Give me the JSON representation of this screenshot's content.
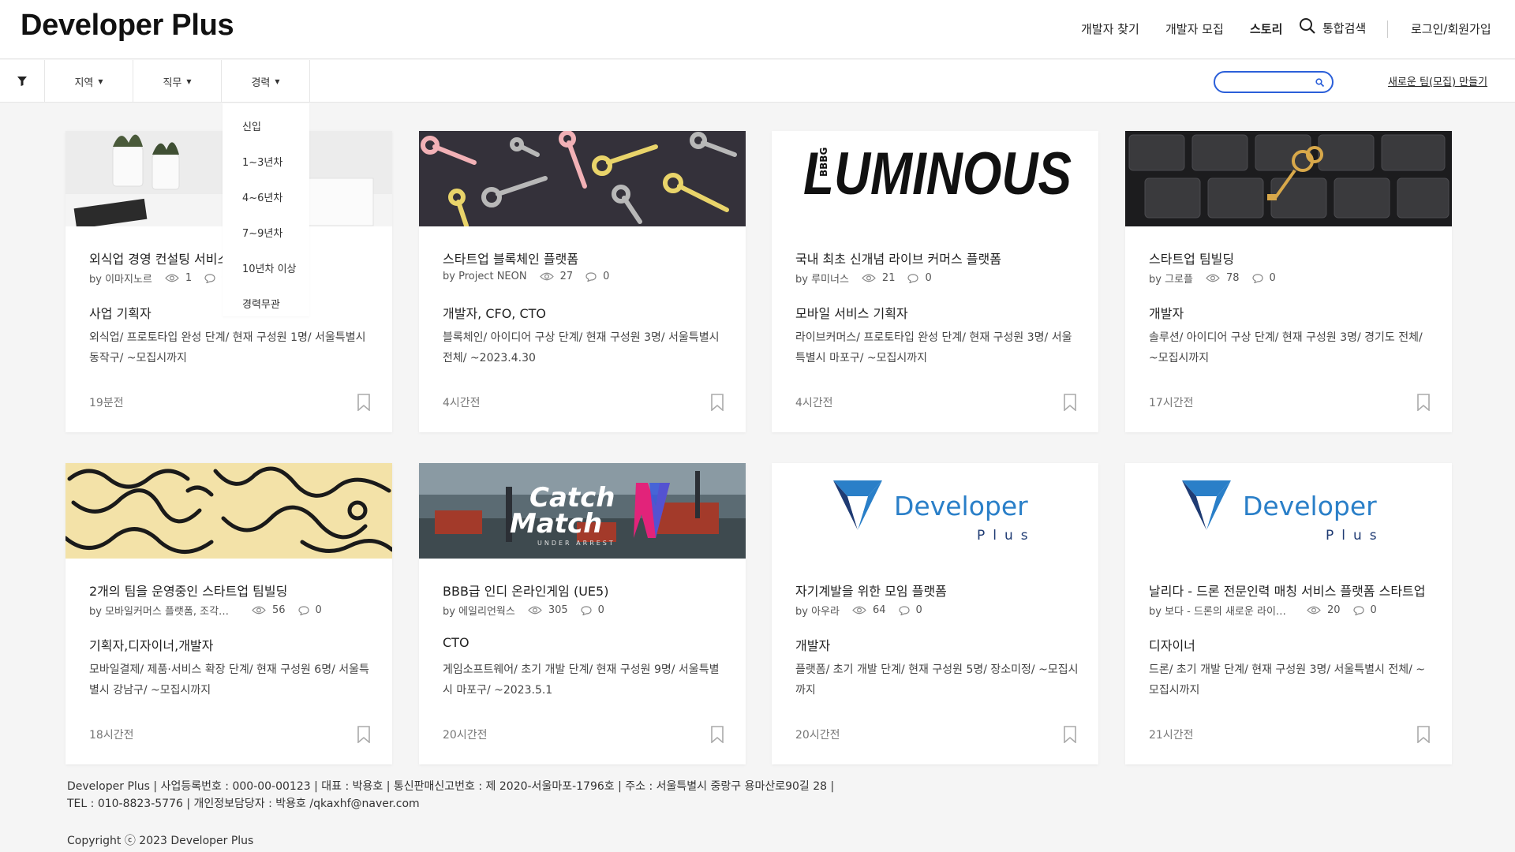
{
  "header": {
    "logo": "Developer Plus",
    "nav": {
      "find_dev": "개발자 찾기",
      "recruit_dev": "개발자 모집",
      "story": "스토리",
      "search": "통합검색",
      "login": "로그인/회원가입"
    }
  },
  "filters": {
    "region": "지역",
    "job": "직무",
    "career": "경력",
    "caret": "▼",
    "search_placeholder": "",
    "new_team": "새로운 팀(모집) 만들기"
  },
  "career_dropdown": [
    "신입",
    "1~3년차",
    "4~6년차",
    "7~9년차",
    "10년차 이상",
    "경력무관"
  ],
  "cards": [
    {
      "title": "외식업 경영 컨설팅 서비스",
      "by": "by 이마지노르",
      "views": "1",
      "comments": "0",
      "role": "사업 기획자",
      "desc": "외식업/ 프로토타입 완성 단계/ 현재 구성원 1명/ 서울특별시 동작구/ ~모집시까지",
      "time": "19분전",
      "image": "desk-plants"
    },
    {
      "title": "스타트업 블록체인 플랫폼",
      "by": "by Project NEON",
      "views": "27",
      "comments": "0",
      "role": "개발자, CFO, CTO",
      "desc": "블록체인/ 아이디어 구상 단계/ 현재 구성원 3명/ 서울특별시 전체/ ~2023.4.30",
      "time": "4시간전",
      "image": "colorful-keys"
    },
    {
      "title": "국내 최초 신개념 라이브 커머스 플랫폼",
      "by": "by 루미너스",
      "views": "21",
      "comments": "0",
      "role": "모바일 서비스 기획자",
      "desc": "라이브커머스/ 프로토타입 완성 단계/ 현재 구성원 3명/ 서울특별시 마포구/ ~모집시까지",
      "time": "4시간전",
      "image": "luminous-logo",
      "logo_text": "LUMINOUS",
      "logo_small": "BBBG"
    },
    {
      "title": "스타트업 팀빌딩",
      "by": "by 그로플",
      "views": "78",
      "comments": "0",
      "role": "개발자",
      "desc": "솔루션/ 아이디어 구상 단계/ 현재 구성원 3명/ 경기도 전체/ ~모집시까지",
      "time": "17시간전",
      "image": "keyboard-key"
    },
    {
      "title": "2개의 팀을 운영중인 스타트업 팀빌딩",
      "by": "by 모바일커머스 플랫폼, 조각투자 플랫폼",
      "views": "56",
      "comments": "0",
      "role": "기획자,디자이너,개발자",
      "desc": "모바일결제/ 제품·서비스 확장 단계/ 현재 구성원 6명/ 서울특별시 강남구/ ~모집시까지",
      "time": "18시간전",
      "image": "squiggle-pattern"
    },
    {
      "title": "BBB급 인디 온라인게임 (UE5)",
      "by": "by 에일리언웍스",
      "views": "305",
      "comments": "0",
      "role": "CTO",
      "desc": "게임소프트웨어/ 초기 개발 단계/ 현재 구성원 9명/ 서울특별시 마포구/ ~2023.5.1",
      "time": "20시간전",
      "image": "catch-match-game",
      "logo_line1": "Catch",
      "logo_line2": "Match",
      "logo_sub": "UNDER ARREST"
    },
    {
      "title": "자기계발을 위한 모임 플랫폼",
      "by": "by 아우라",
      "views": "64",
      "comments": "0",
      "role": "개발자",
      "desc": "플랫폼/ 초기 개발 단계/ 현재 구성원 5명/ 장소미정/ ~모집시까지",
      "time": "20시간전",
      "image": "developer-plus-logo",
      "logo_text": "Developer",
      "logo_sub": "Plus"
    },
    {
      "title": "날리다 - 드론 전문인력 매칭 서비스 플랫폼 스타트업",
      "by": "by 보다 - 드론의 새로운 라이프스타일",
      "views": "20",
      "comments": "0",
      "role": "디자이너",
      "desc": "드론/ 초기 개발 단계/ 현재 구성원 3명/ 서울특별시 전체/ ~모집시까지",
      "time": "21시간전",
      "image": "developer-plus-logo",
      "logo_text": "Developer",
      "logo_sub": "Plus"
    }
  ],
  "footer": {
    "line1": "Developer Plus | 사업등록번호 : 000-00-00123 | 대표 : 박용호 | 통신판매신고번호 : 제 2020-서울마포-1796호 | 주소 : 서울특별시 중랑구 용마산로90길 28 |",
    "line2": "TEL : 010-8823-5776 | 개인정보담당자 : 박용호 /qkaxhf@naver.com",
    "copyright": "Copyright ⓒ 2023 Developer Plus"
  },
  "colors": {
    "accent_blue": "#2b5fd9",
    "logo_blue": "#2a7fc8",
    "logo_navy": "#1f3b73"
  }
}
